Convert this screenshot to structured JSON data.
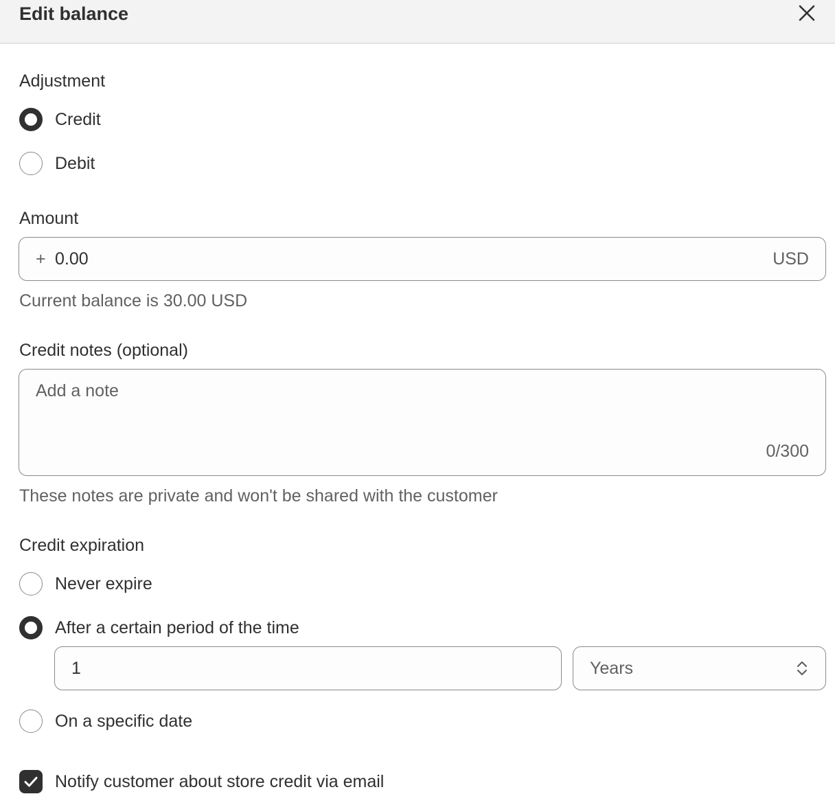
{
  "header": {
    "title": "Edit balance",
    "close_icon": "close-icon"
  },
  "adjustment": {
    "label": "Adjustment",
    "options": [
      {
        "label": "Credit",
        "selected": true
      },
      {
        "label": "Debit",
        "selected": false
      }
    ]
  },
  "amount": {
    "label": "Amount",
    "prefix": "+",
    "value": "0.00",
    "currency": "USD",
    "help": "Current balance is 30.00 USD"
  },
  "notes": {
    "label": "Credit notes (optional)",
    "placeholder": "Add a note",
    "counter": "0/300",
    "help": "These notes are private and won't be shared with the customer"
  },
  "expiration": {
    "label": "Credit expiration",
    "options": [
      {
        "label": "Never expire",
        "selected": false
      },
      {
        "label": "After a certain period of the time",
        "selected": true
      },
      {
        "label": "On a specific date",
        "selected": false
      }
    ],
    "period_value": "1",
    "period_unit": "Years"
  },
  "notify": {
    "label": "Notify customer about store credit via email",
    "checked": true
  },
  "colors": {
    "primary": "#303030",
    "muted": "#616161",
    "border": "#8a8a8a",
    "header_bg": "#f3f3f3"
  }
}
